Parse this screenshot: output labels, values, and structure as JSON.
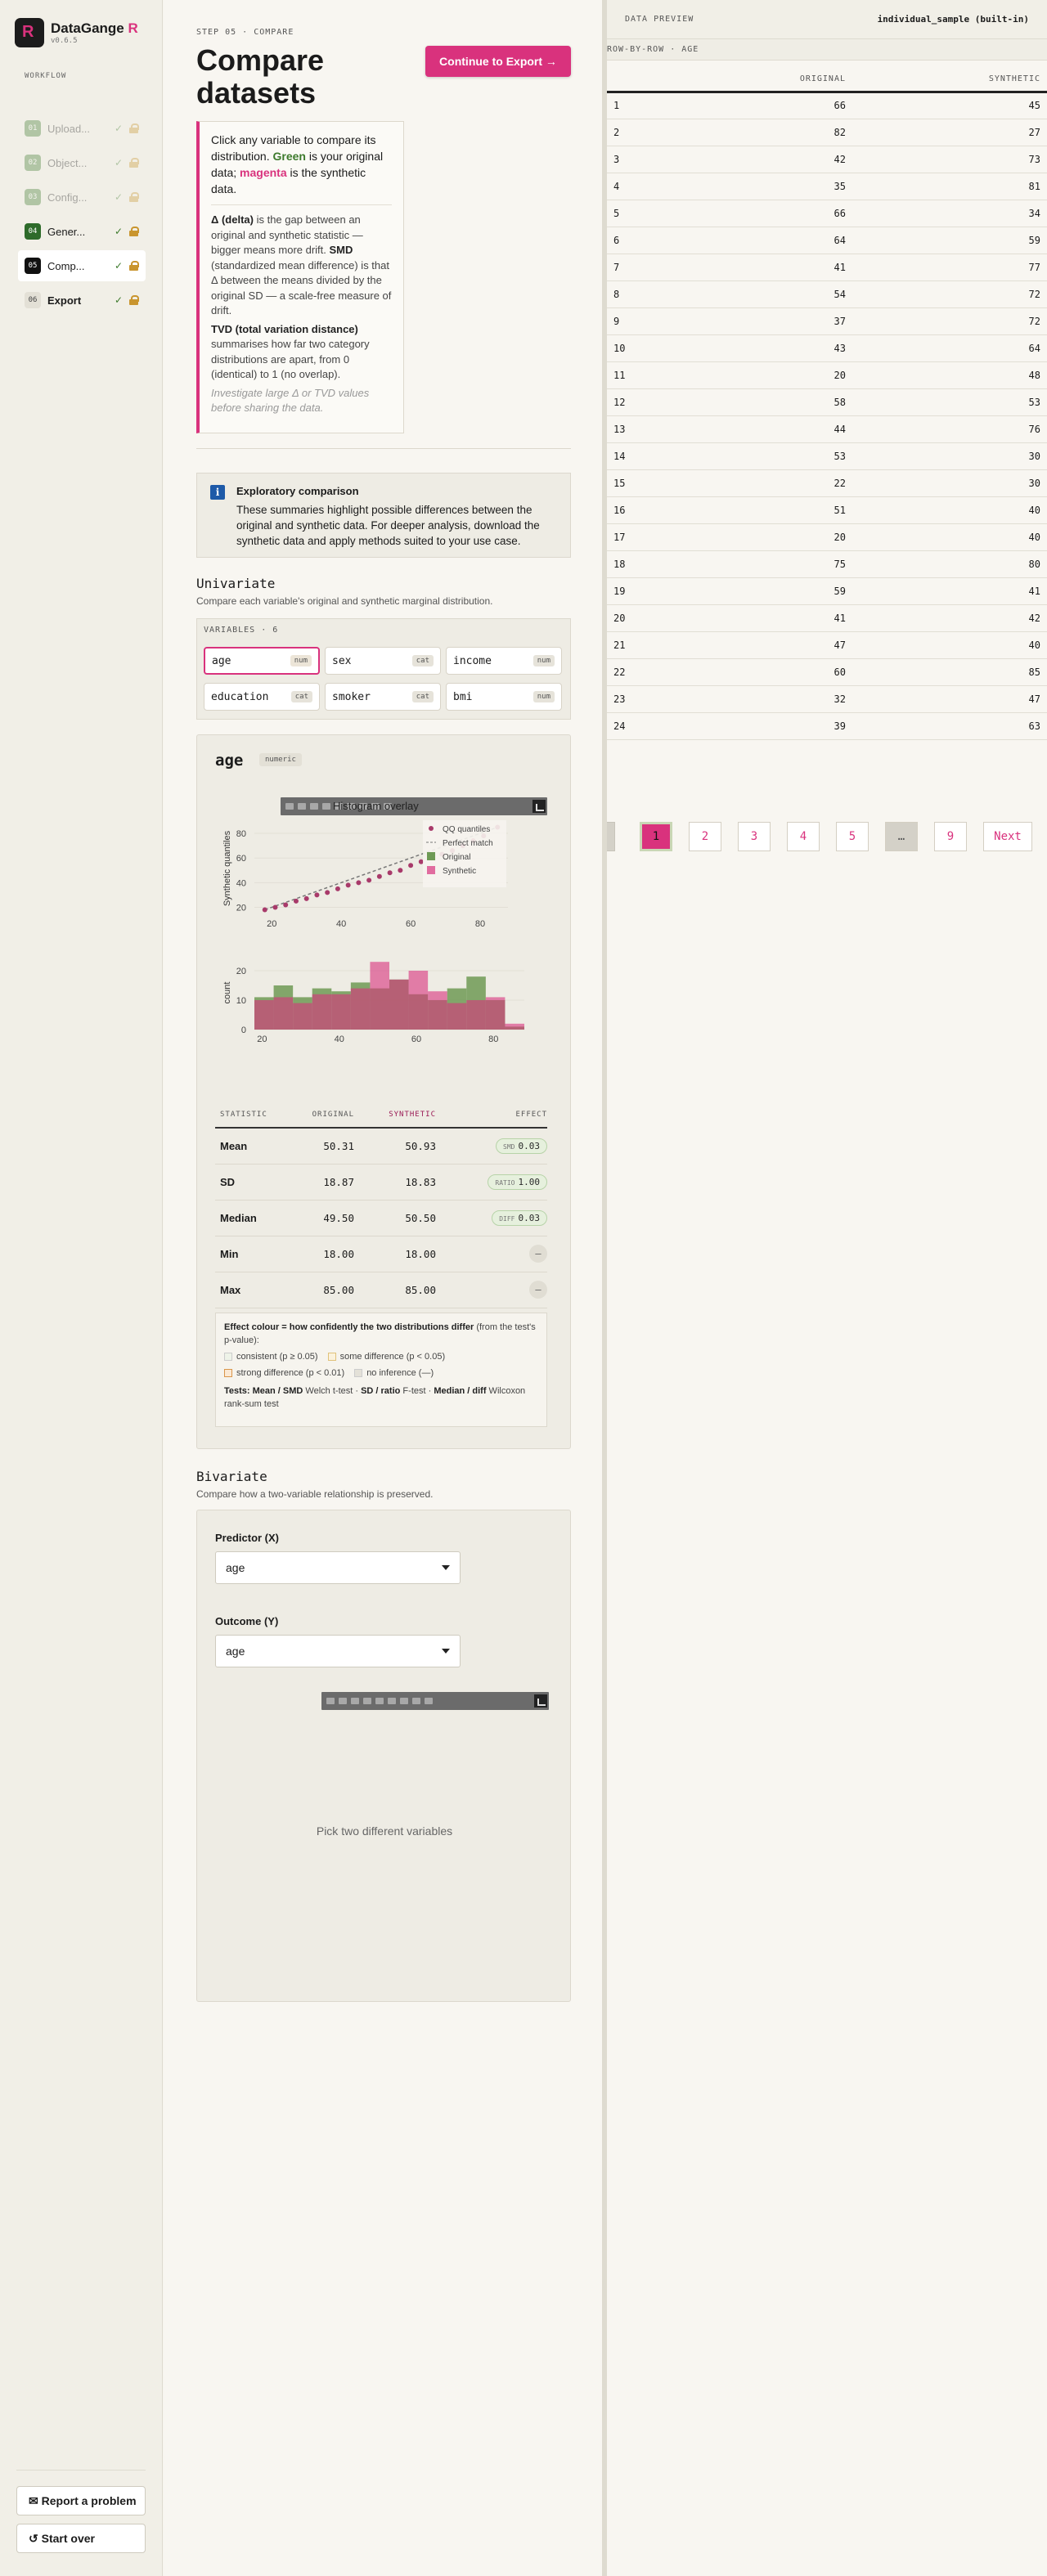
{
  "app": {
    "name": "DataGange",
    "name_r": "R",
    "version": "v0.6.5",
    "logo_letter": "R"
  },
  "sidebar": {
    "workflow_label": "WORKFLOW",
    "steps": [
      {
        "num": "01",
        "label": "Upload...",
        "state": "done-dim"
      },
      {
        "num": "02",
        "label": "Object...",
        "state": "done-dim"
      },
      {
        "num": "03",
        "label": "Config...",
        "state": "done-dim"
      },
      {
        "num": "04",
        "label": "Gener...",
        "state": "done"
      },
      {
        "num": "05",
        "label": "Comp...",
        "state": "active"
      },
      {
        "num": "06",
        "label": "Export",
        "state": "next"
      }
    ],
    "check": "✓",
    "report_label": "✉ Report a problem",
    "startover_label": "↺ Start over"
  },
  "main": {
    "step_label": "STEP 05 · COMPARE",
    "title": "Compare datasets",
    "cta": "Continue to Export →",
    "hint": {
      "p1_a": "Click any variable to compare its distribution. ",
      "green": "Green",
      "p1_b": " is your original data; ",
      "magenta": "magenta",
      "p1_c": " is the synthetic data.",
      "delta_b": "Δ (delta)",
      "delta_t": " is the gap between an original and synthetic statistic — bigger means more drift. ",
      "smd_b": "SMD",
      "smd_t": " (standardized mean difference) is that Δ between the means divided by the original SD — a scale-free measure of drift.",
      "tvd_b": "TVD (total variation distance)",
      "tvd_t": " summarises how far two category distributions are apart, from 0 (identical) to 1 (no overlap).",
      "italic": "Investigate large Δ or TVD values before sharing the data."
    },
    "notice": {
      "icon": "i",
      "title": "Exploratory comparison",
      "body": "These summaries highlight possible differences between the original and synthetic data. For deeper analysis, download the synthetic data and apply methods suited to your use case."
    },
    "univariate": {
      "heading": "Univariate",
      "sub": "Compare each variable's original and synthetic marginal distribution.",
      "vars_label": "VARIABLES · 6",
      "variables": [
        {
          "name": "age",
          "tag": "num"
        },
        {
          "name": "sex",
          "tag": "cat"
        },
        {
          "name": "income",
          "tag": "num"
        },
        {
          "name": "education",
          "tag": "cat"
        },
        {
          "name": "smoker",
          "tag": "cat"
        },
        {
          "name": "bmi",
          "tag": "num"
        }
      ]
    },
    "var_card": {
      "name": "age",
      "type": "numeric",
      "overlay_title": "Histogram overlay",
      "qq_legend": [
        "QQ quantiles",
        "Perfect match",
        "Original",
        "Synthetic"
      ],
      "qq_ylabel": "Synthetic quantiles",
      "hist_ylabel": "count",
      "stats_headers": [
        "STATISTIC",
        "ORIGINAL",
        "SYNTHETIC",
        "EFFECT"
      ],
      "stats": [
        {
          "name": "Mean",
          "orig": "50.31",
          "syn": "50.93",
          "effect_tag": "SMD",
          "effect_val": "0.03"
        },
        {
          "name": "SD",
          "orig": "18.87",
          "syn": "18.83",
          "effect_tag": "RATIO",
          "effect_val": "1.00"
        },
        {
          "name": "Median",
          "orig": "49.50",
          "syn": "50.50",
          "effect_tag": "DIFF",
          "effect_val": "0.03"
        },
        {
          "name": "Min",
          "orig": "18.00",
          "syn": "18.00",
          "effect_tag": "",
          "effect_val": "—"
        },
        {
          "name": "Max",
          "orig": "85.00",
          "syn": "85.00",
          "effect_tag": "",
          "effect_val": "—"
        }
      ],
      "legend": {
        "intro_b": "Effect colour = how confidently the two distributions differ",
        "intro_t": " (from the test's p-value):",
        "items": [
          "consistent (p ≥ 0.05)",
          "some difference (p < 0.05)",
          "strong difference (p < 0.01)",
          "no inference (—)"
        ],
        "tests_b1": "Tests: Mean / SMD",
        "tests_t1": " Welch t-test · ",
        "tests_b2": "SD / ratio",
        "tests_t2": " F-test · ",
        "tests_b3": "Median / diff",
        "tests_t3": " Wilcoxon rank-sum test"
      }
    },
    "bivariate": {
      "heading": "Bivariate",
      "sub": "Compare how a two-variable relationship is preserved.",
      "predictor_label": "Predictor (X)",
      "predictor_value": "age",
      "outcome_label": "Outcome (Y)",
      "outcome_value": "age",
      "empty": "Pick two different variables"
    }
  },
  "preview": {
    "label": "DATA PREVIEW",
    "dataset": "individual_sample (built-in)",
    "sub": "ROW-BY-ROW · AGE",
    "headers": [
      "",
      "ORIGINAL",
      "SYNTHETIC"
    ],
    "rows": [
      [
        "1",
        "66",
        "45"
      ],
      [
        "2",
        "82",
        "27"
      ],
      [
        "3",
        "42",
        "73"
      ],
      [
        "4",
        "35",
        "81"
      ],
      [
        "5",
        "66",
        "34"
      ],
      [
        "6",
        "64",
        "59"
      ],
      [
        "7",
        "41",
        "77"
      ],
      [
        "8",
        "54",
        "72"
      ],
      [
        "9",
        "37",
        "72"
      ],
      [
        "10",
        "43",
        "64"
      ],
      [
        "11",
        "20",
        "48"
      ],
      [
        "12",
        "58",
        "53"
      ],
      [
        "13",
        "44",
        "76"
      ],
      [
        "14",
        "53",
        "30"
      ],
      [
        "15",
        "22",
        "30"
      ],
      [
        "16",
        "51",
        "40"
      ],
      [
        "17",
        "20",
        "40"
      ],
      [
        "18",
        "75",
        "80"
      ],
      [
        "19",
        "59",
        "41"
      ],
      [
        "20",
        "41",
        "42"
      ],
      [
        "21",
        "47",
        "40"
      ],
      [
        "22",
        "60",
        "85"
      ],
      [
        "23",
        "32",
        "47"
      ],
      [
        "24",
        "39",
        "63"
      ]
    ],
    "pages": [
      "1",
      "2",
      "3",
      "4",
      "5",
      "…",
      "9"
    ],
    "next": "Next"
  },
  "colors": {
    "accent": "#d9327d",
    "original": "#6e9a55",
    "synthetic": "#d9327d"
  },
  "chart_data": [
    {
      "type": "scatter",
      "title": "",
      "xlabel": "",
      "ylabel": "Synthetic quantiles",
      "xlim": [
        15,
        88
      ],
      "ylim": [
        15,
        88
      ],
      "xticks": [
        20,
        40,
        60,
        80
      ],
      "yticks": [
        20,
        40,
        60,
        80
      ],
      "series": [
        {
          "name": "QQ quantiles",
          "points": [
            [
              18,
              18
            ],
            [
              21,
              20
            ],
            [
              24,
              22
            ],
            [
              27,
              25
            ],
            [
              30,
              27
            ],
            [
              33,
              30
            ],
            [
              36,
              32
            ],
            [
              39,
              35
            ],
            [
              42,
              38
            ],
            [
              45,
              40
            ],
            [
              48,
              42
            ],
            [
              51,
              45
            ],
            [
              54,
              48
            ],
            [
              57,
              50
            ],
            [
              60,
              54
            ],
            [
              63,
              57
            ],
            [
              66,
              60
            ],
            [
              69,
              63
            ],
            [
              72,
              66
            ],
            [
              75,
              70
            ],
            [
              78,
              74
            ],
            [
              81,
              78
            ],
            [
              85,
              85
            ]
          ]
        },
        {
          "name": "Perfect match",
          "line": [
            [
              18,
              18
            ],
            [
              85,
              85
            ]
          ]
        }
      ]
    },
    {
      "type": "bar",
      "title": "",
      "ylabel": "count",
      "xticks": [
        20,
        40,
        60,
        80
      ],
      "ylim": [
        0,
        25
      ],
      "yticks": [
        0,
        10,
        20
      ],
      "bin_edges": [
        18,
        23,
        28,
        33,
        38,
        43,
        48,
        53,
        58,
        63,
        68,
        73,
        78,
        83,
        88
      ],
      "series": [
        {
          "name": "Original",
          "values": [
            11,
            15,
            11,
            14,
            13,
            16,
            14,
            17,
            12,
            10,
            14,
            18,
            10,
            1
          ]
        },
        {
          "name": "Synthetic",
          "values": [
            10,
            11,
            9,
            12,
            12,
            14,
            23,
            17,
            20,
            13,
            9,
            10,
            11,
            2
          ]
        }
      ]
    }
  ]
}
